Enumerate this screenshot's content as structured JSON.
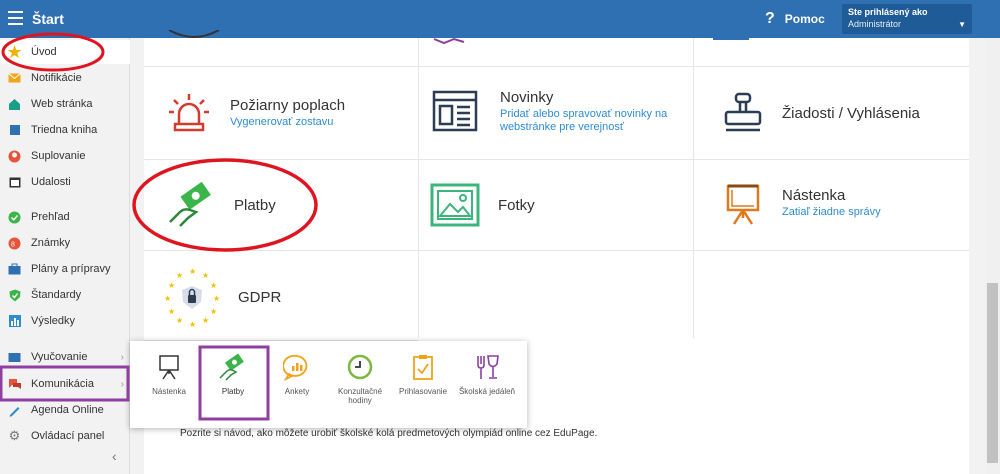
{
  "header": {
    "title": "Štart",
    "help_label": "Pomoc",
    "user_line1": "Ste prihlásený ako",
    "user_line2": "Administrátor"
  },
  "sidebar": {
    "items": [
      {
        "label": "Úvod"
      },
      {
        "label": "Notifikácie"
      },
      {
        "label": "Web stránka"
      },
      {
        "label": "Triedna kniha"
      },
      {
        "label": "Suplovanie"
      },
      {
        "label": "Udalosti"
      },
      {
        "label": "Prehľad"
      },
      {
        "label": "Známky"
      },
      {
        "label": "Plány a prípravy"
      },
      {
        "label": "Štandardy"
      },
      {
        "label": "Výsledky"
      },
      {
        "label": "Vyučovanie"
      },
      {
        "label": "Komunikácia"
      },
      {
        "label": "Agenda Online"
      },
      {
        "label": "Ovládací panel"
      }
    ]
  },
  "tiles": {
    "fire": {
      "title": "Požiarny poplach",
      "sub": "Vygenerovať zostavu"
    },
    "news": {
      "title": "Novinky",
      "sub1": "Pridať alebo spravovať novinky na",
      "sub2": "webstránke pre verejnosť"
    },
    "requests": {
      "title": "Žiadosti / Vyhlásenia"
    },
    "payments": {
      "title": "Platby"
    },
    "photos": {
      "title": "Fotky"
    },
    "board": {
      "title": "Nástenka",
      "sub": "Zatiaľ žiadne správy"
    },
    "gdpr": {
      "title": "GDPR"
    }
  },
  "popup": {
    "items": [
      {
        "label": "Nástenka"
      },
      {
        "label": "Platby"
      },
      {
        "label": "Ankety"
      },
      {
        "label": "Konzultačné hodiny"
      },
      {
        "label": "Prihlasovanie"
      },
      {
        "label": "Školská jedáleň"
      }
    ]
  },
  "bottom": {
    "line1": "Pozrite si návod, ako môžete urobiť školské kolá predmetových olympiád online cez EduPage."
  },
  "colors": {
    "header": "#2e70b1",
    "annot_red": "#e0141e",
    "annot_purple": "#8e3fa0",
    "link": "#2e8cd0"
  }
}
